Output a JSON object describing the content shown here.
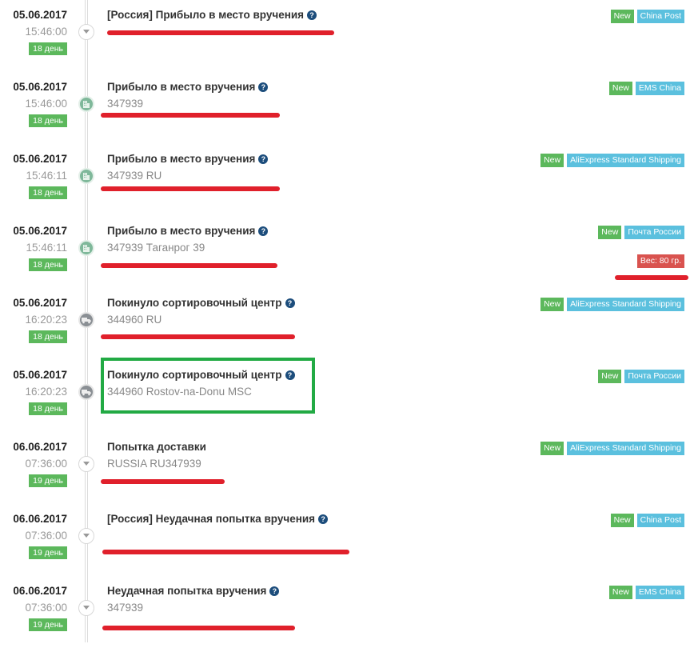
{
  "events": [
    {
      "date": "05.06.2017",
      "time": "15:46:00",
      "day": "18 день",
      "title": "[Россия] Прибыло в место вручения",
      "help": "?",
      "location": "",
      "node_icon": "arrow-down",
      "tags": [
        "New",
        "China Post"
      ]
    },
    {
      "date": "05.06.2017",
      "time": "15:46:00",
      "day": "18 день",
      "title": "Прибыло в место вручения",
      "help": "?",
      "location": "347939",
      "node_icon": "building",
      "tags": [
        "New",
        "EMS China"
      ]
    },
    {
      "date": "05.06.2017",
      "time": "15:46:11",
      "day": "18 день",
      "title": "Прибыло в место вручения",
      "help": "?",
      "location": "347939 RU",
      "node_icon": "building",
      "tags": [
        "New",
        "AliExpress Standard Shipping"
      ]
    },
    {
      "date": "05.06.2017",
      "time": "15:46:11",
      "day": "18 день",
      "title": "Прибыло в место вручения",
      "help": "?",
      "location": "347939 Таганрог 39",
      "node_icon": "building",
      "tags": [
        "New",
        "Почта России"
      ],
      "weight": "Вес: 80 гр."
    },
    {
      "date": "05.06.2017",
      "time": "16:20:23",
      "day": "18 день",
      "title": "Покинуло сортировочный центр",
      "help": "?",
      "location": "344960 RU",
      "node_icon": "truck",
      "tags": [
        "New",
        "AliExpress Standard Shipping"
      ]
    },
    {
      "date": "05.06.2017",
      "time": "16:20:23",
      "day": "18 день",
      "title": "Покинуло сортировочный центр",
      "help": "?",
      "location": "344960 Rostov-na-Donu MSC",
      "node_icon": "truck",
      "tags": [
        "New",
        "Почта России"
      ]
    },
    {
      "date": "06.06.2017",
      "time": "07:36:00",
      "day": "19 день",
      "title": "Попытка доставки",
      "help": "",
      "location": "RUSSIA RU347939",
      "node_icon": "arrow-down",
      "tags": [
        "New",
        "AliExpress Standard Shipping"
      ]
    },
    {
      "date": "06.06.2017",
      "time": "07:36:00",
      "day": "19 день",
      "title": "[Россия] Неудачная попытка вручения",
      "help": "?",
      "location": "",
      "node_icon": "arrow-down",
      "tags": [
        "New",
        "China Post"
      ]
    },
    {
      "date": "06.06.2017",
      "time": "07:36:00",
      "day": "19 день",
      "title": "Неудачная попытка вручения",
      "help": "?",
      "location": "347939",
      "node_icon": "arrow-down",
      "tags": [
        "New",
        "EMS China"
      ]
    }
  ],
  "colors": {
    "new_badge": "#5cb85c",
    "carrier_badge": "#5bc0de",
    "weight_badge": "#d9534f",
    "day_badge": "#5cb85c",
    "redaction": "#e0202b",
    "highlight": "#22aa44"
  }
}
